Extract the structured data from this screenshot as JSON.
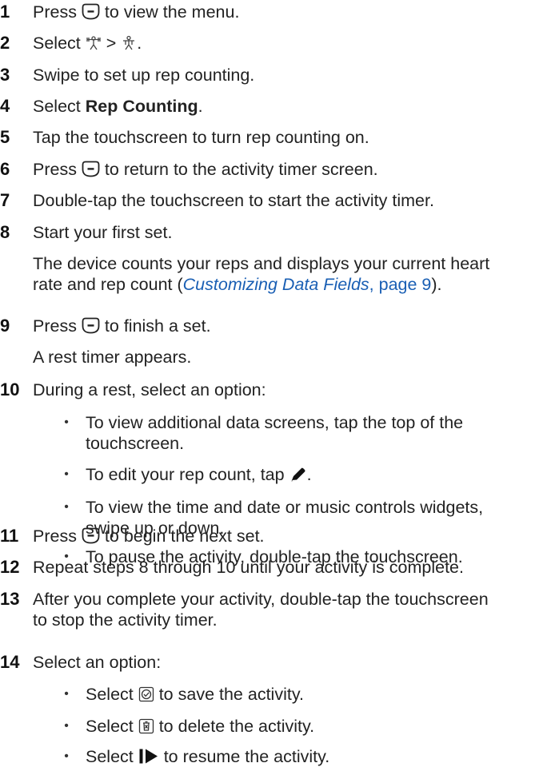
{
  "steps": [
    {
      "number": "1",
      "lines": [
        {
          "pre": "Press ",
          "icon": "minus-button-icon",
          "post": " to view the menu."
        }
      ]
    },
    {
      "number": "2",
      "lines": [
        {
          "pre": "Select ",
          "icon": "strength-activity-icon",
          "mid": " > ",
          "icon2": "rep-settings-icon",
          "post": "."
        }
      ]
    },
    {
      "number": "3",
      "lines": [
        {
          "text": "Swipe to set up rep counting."
        }
      ]
    },
    {
      "number": "4",
      "lines": [
        {
          "pre": "Select ",
          "bold": "Rep Counting",
          "post": "."
        }
      ]
    },
    {
      "number": "5",
      "lines": [
        {
          "text": "Tap the touchscreen to turn rep counting on."
        }
      ]
    },
    {
      "number": "6",
      "lines": [
        {
          "pre": "Press ",
          "icon": "minus-button-icon",
          "post": " to return to the activity timer screen."
        }
      ]
    },
    {
      "number": "7",
      "lines": [
        {
          "text": "Double-tap the touchscreen to start the activity timer."
        }
      ]
    },
    {
      "number": "8",
      "lines": [
        {
          "text": "Start your first set."
        },
        {
          "text": "The device counts your reps and displays your current heart"
        },
        {
          "pre": "rate and rep count (",
          "link": "Customizing Data Fields",
          "linkpage": ", page 9",
          "post": ")."
        }
      ]
    },
    {
      "number": "9",
      "lines": [
        {
          "pre": "Press ",
          "icon": "minus-button-icon",
          "post": " to finish a set."
        },
        {
          "text": "A rest timer appears."
        }
      ]
    },
    {
      "number": "10",
      "lines": [
        {
          "text": "During a rest, select an option:"
        }
      ]
    },
    {
      "number": "11",
      "lines": [
        {
          "pre": "Press ",
          "icon": "minus-button-icon",
          "post": " to begin the next set."
        }
      ]
    },
    {
      "number": "12",
      "lines": [
        {
          "text": "Repeat steps 8 through 10 until your activity is complete."
        }
      ]
    },
    {
      "number": "13",
      "lines": [
        {
          "text": "After you complete your activity, double-tap the touchscreen"
        },
        {
          "text": "to stop the activity timer."
        }
      ]
    },
    {
      "number": "14",
      "lines": [
        {
          "text": "Select an option:"
        }
      ]
    }
  ],
  "rest_options": [
    {
      "lines": [
        {
          "text": "To view additional data screens, tap the top of the"
        },
        {
          "text": "touchscreen."
        }
      ]
    },
    {
      "lines": [
        {
          "pre": "To edit your rep count, tap ",
          "icon": "pencil-icon",
          "post": "."
        }
      ]
    },
    {
      "lines": [
        {
          "text": "To view the time and date or music controls widgets,"
        },
        {
          "text": "swipe up or down."
        }
      ]
    },
    {
      "lines": [
        {
          "text": "To pause the activity, double-tap the touchscreen."
        }
      ]
    }
  ],
  "final_options": [
    {
      "lines": [
        {
          "pre": "Select ",
          "icon": "save-check-icon",
          "post": " to save the activity."
        }
      ]
    },
    {
      "lines": [
        {
          "pre": "Select ",
          "icon": "discard-trash-icon",
          "post": " to delete the activity."
        }
      ]
    },
    {
      "lines": [
        {
          "pre": "Select ",
          "icon": "resume-play-icon",
          "post": " to resume the activity."
        }
      ]
    }
  ],
  "bullet_glyph": "•",
  "colors": {
    "text": "#222222",
    "link": "#1a5fb4"
  }
}
